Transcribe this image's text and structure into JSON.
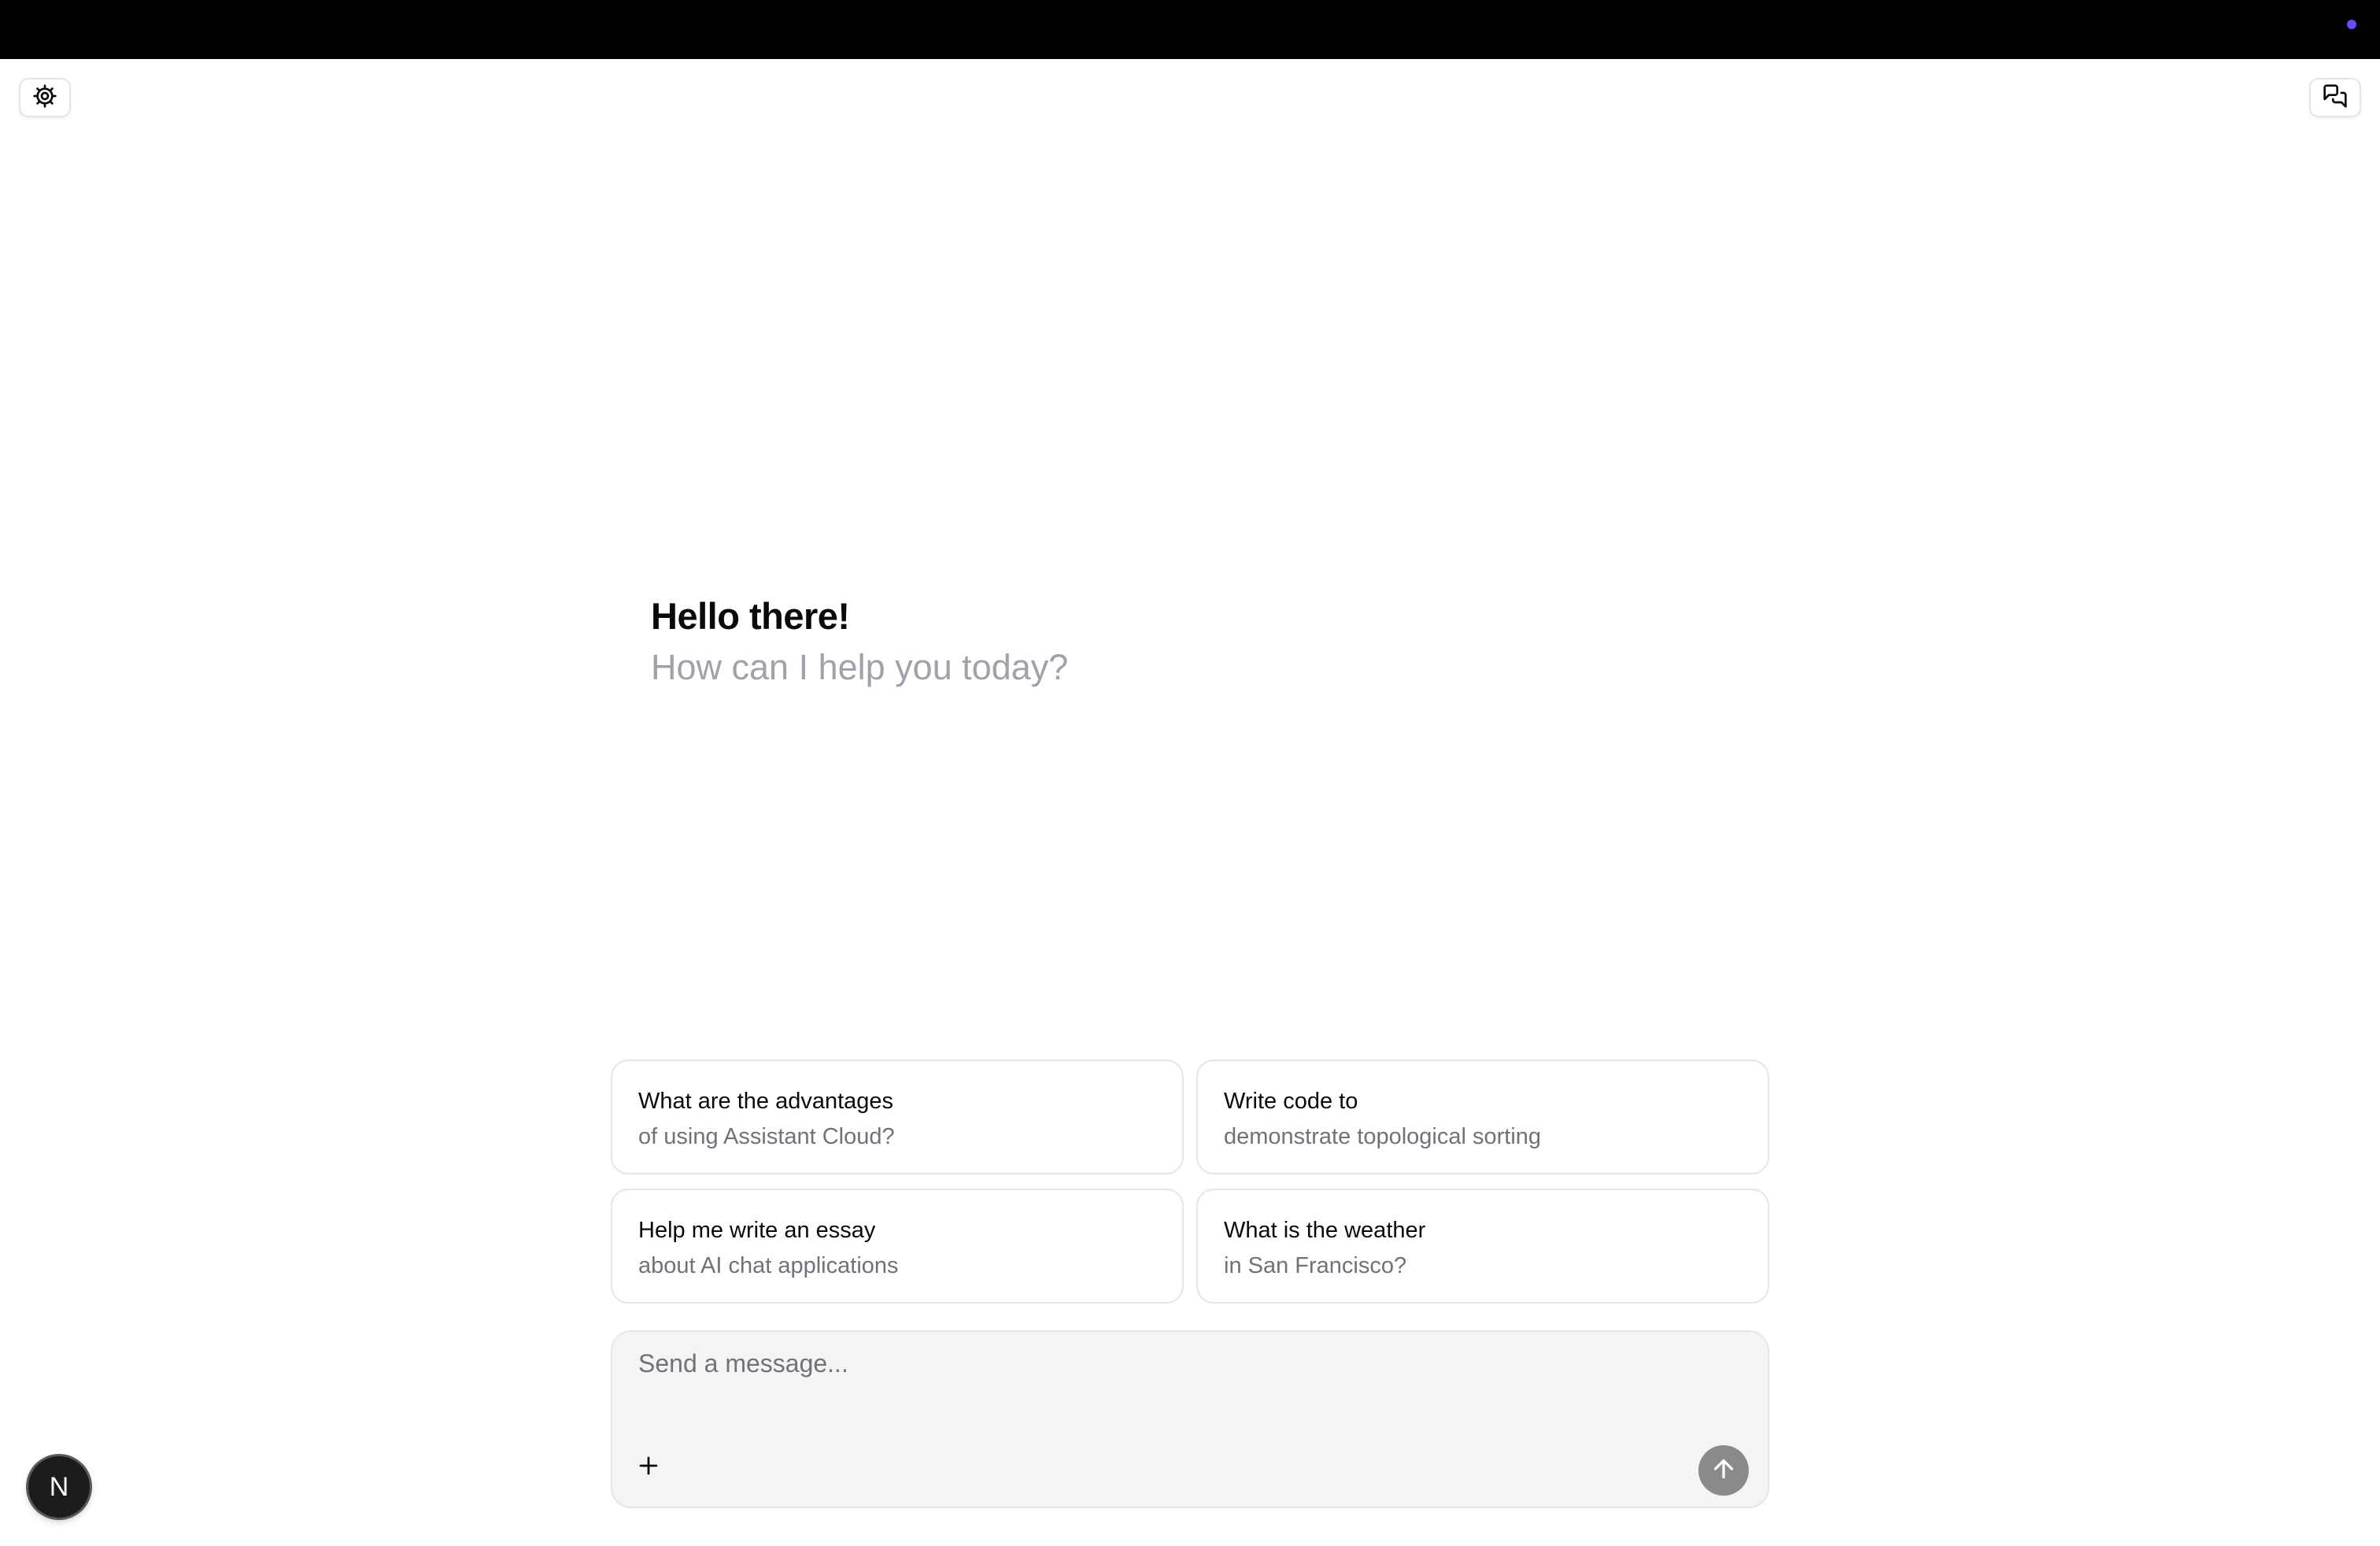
{
  "header": {
    "settings_icon": "gear-icon",
    "chats_icon": "chat-bubbles-icon",
    "status_dot_color": "#6d4aff"
  },
  "welcome": {
    "title": "Hello there!",
    "subtitle": "How can I help you today?"
  },
  "suggestions": [
    {
      "line1": "What are the advantages",
      "line2": "of using Assistant Cloud?"
    },
    {
      "line1": "Write code to",
      "line2": "demonstrate topological sorting"
    },
    {
      "line1": "Help me write an essay",
      "line2": "about AI chat applications"
    },
    {
      "line1": "What is the weather",
      "line2": "in San Francisco?"
    }
  ],
  "composer": {
    "placeholder": "Send a message...",
    "value": "",
    "add_icon": "plus-icon",
    "send_icon": "arrow-up-icon"
  },
  "dev_badge": {
    "letter": "N"
  }
}
